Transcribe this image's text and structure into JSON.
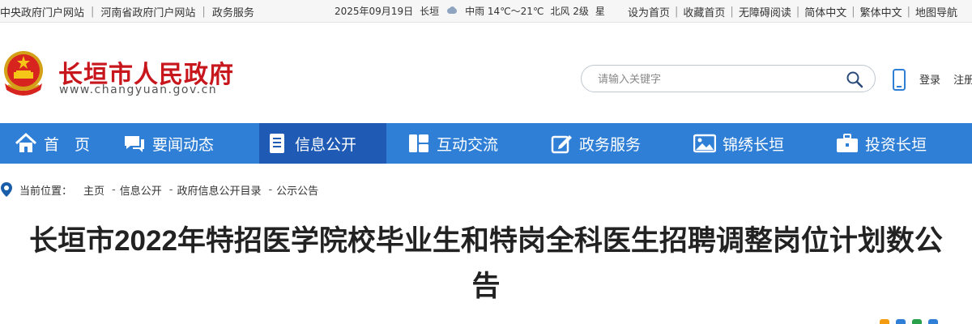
{
  "topbar": {
    "links_left": [
      "中央政府门户网站",
      "河南省政府门户网站",
      "政务服务"
    ],
    "date": "2025年09月19日",
    "city": "长垣",
    "weather": "中雨 14℃～21℃",
    "wind": "北风 2级",
    "weekday": "星",
    "links_right": [
      "设为首页",
      "收藏首页",
      "无障碍阅读",
      "简体中文",
      "繁体中文",
      "地图导航"
    ]
  },
  "header": {
    "site_title": "长垣市人民政府",
    "site_domain": "www.changyuan.gov.cn",
    "search_placeholder": "请输入关键字",
    "login": "登录",
    "register": "注册"
  },
  "nav": {
    "items": [
      {
        "label": "首　页",
        "icon": "home-icon"
      },
      {
        "label": "要闻动态",
        "icon": "chat-bubble-icon"
      },
      {
        "label": "信息公开",
        "icon": "document-list-icon"
      },
      {
        "label": "互动交流",
        "icon": "grid-panels-icon"
      },
      {
        "label": "政务服务",
        "icon": "edit-square-icon"
      },
      {
        "label": "锦绣长垣",
        "icon": "landscape-picture-icon"
      },
      {
        "label": "投资长垣",
        "icon": "briefcase-icon"
      }
    ],
    "active_index": 2
  },
  "breadcrumb": {
    "label": "当前位置：",
    "items": [
      "主页",
      "信息公开",
      "政府信息公开目录",
      "公示公告"
    ]
  },
  "article": {
    "title": "长垣市2022年特招医学院校毕业生和特岗全科医生招聘调整岗位计划数公告"
  },
  "colors": {
    "brand_red": "#c8161d",
    "nav_blue": "#2f7fd6",
    "nav_active": "#1f5ab4"
  }
}
